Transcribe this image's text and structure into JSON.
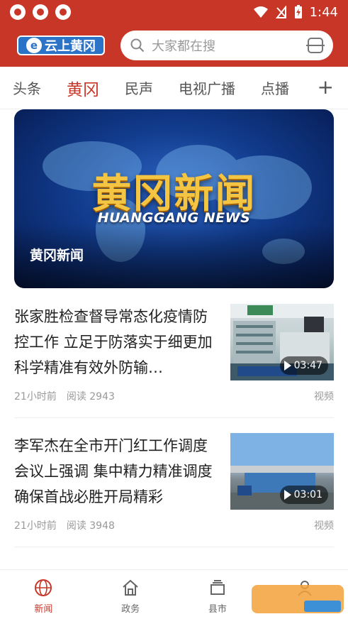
{
  "status_bar": {
    "time": "1:44"
  },
  "header": {
    "logo_text": "云上黄冈",
    "search_placeholder": "大家都在搜"
  },
  "tabs": [
    {
      "label": "头条",
      "active": false
    },
    {
      "label": "黄冈",
      "active": true
    },
    {
      "label": "民声",
      "active": false
    },
    {
      "label": "电视广播",
      "active": false
    },
    {
      "label": "点播",
      "active": false
    }
  ],
  "tabs_more": "+",
  "banner": {
    "title_art": "黄冈新闻",
    "subtitle_art": "HUANGGANG NEWS",
    "caption": "黄冈新闻"
  },
  "news": [
    {
      "title": "张家胜检查督导常态化疫情防控工作 立足于防落实于细更加科学精准有效外防输…",
      "time": "21小时前",
      "reads": "阅读 2943",
      "type": "视频",
      "duration": "03:47"
    },
    {
      "title": "李军杰在全市开门红工作调度会议上强调 集中精力精准调度 确保首战必胜开局精彩",
      "time": "21小时前",
      "reads": "阅读 3948",
      "type": "视频",
      "duration": "03:01"
    }
  ],
  "bottom_nav": [
    {
      "label": "新闻",
      "active": true
    },
    {
      "label": "政务",
      "active": false
    },
    {
      "label": "县市",
      "active": false
    }
  ],
  "colors": {
    "brand_red": "#c73627",
    "logo_blue": "#2a73c7"
  }
}
